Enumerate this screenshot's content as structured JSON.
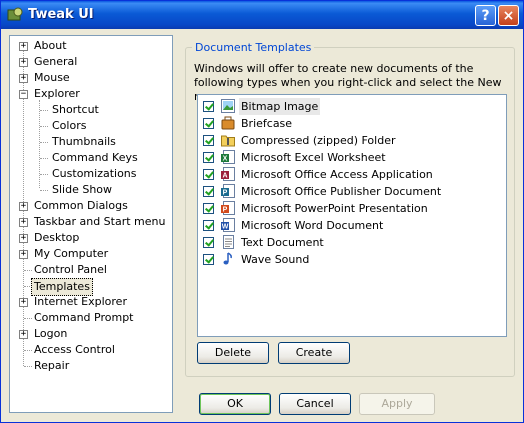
{
  "window": {
    "title": "Tweak UI"
  },
  "titlebar_buttons": {
    "help": "?",
    "close": "×"
  },
  "tree": {
    "items": [
      {
        "label": "About",
        "expander": "+"
      },
      {
        "label": "General",
        "expander": "+"
      },
      {
        "label": "Mouse",
        "expander": "+"
      },
      {
        "label": "Explorer",
        "expander": "−"
      },
      {
        "label": "Shortcut"
      },
      {
        "label": "Colors"
      },
      {
        "label": "Thumbnails"
      },
      {
        "label": "Command Keys"
      },
      {
        "label": "Customizations"
      },
      {
        "label": "Slide Show"
      },
      {
        "label": "Common Dialogs",
        "expander": "+"
      },
      {
        "label": "Taskbar and Start menu",
        "expander": "+"
      },
      {
        "label": "Desktop",
        "expander": "+"
      },
      {
        "label": "My Computer",
        "expander": "+"
      },
      {
        "label": "Control Panel"
      },
      {
        "label": "Templates",
        "selected": true
      },
      {
        "label": "Internet Explorer",
        "expander": "+"
      },
      {
        "label": "Command Prompt"
      },
      {
        "label": "Logon",
        "expander": "+"
      },
      {
        "label": "Access Control"
      },
      {
        "label": "Repair"
      }
    ]
  },
  "panel": {
    "group_title": "Document Templates",
    "description": "Windows will offer to create new documents of the following types when you right-click and select the New menu."
  },
  "templates": [
    {
      "label": "Bitmap Image",
      "checked": true,
      "icon": "bitmap-icon"
    },
    {
      "label": "Briefcase",
      "checked": true,
      "icon": "briefcase-icon"
    },
    {
      "label": "Compressed (zipped) Folder",
      "checked": true,
      "icon": "zip-folder-icon"
    },
    {
      "label": "Microsoft Excel Worksheet",
      "checked": true,
      "icon": "excel-icon"
    },
    {
      "label": "Microsoft Office Access Application",
      "checked": true,
      "icon": "access-icon"
    },
    {
      "label": "Microsoft Office Publisher Document",
      "checked": true,
      "icon": "publisher-icon"
    },
    {
      "label": "Microsoft PowerPoint Presentation",
      "checked": true,
      "icon": "powerpoint-icon"
    },
    {
      "label": "Microsoft Word Document",
      "checked": true,
      "icon": "word-icon"
    },
    {
      "label": "Text Document",
      "checked": true,
      "icon": "text-document-icon"
    },
    {
      "label": "Wave Sound",
      "checked": true,
      "icon": "wave-sound-icon"
    }
  ],
  "buttons": {
    "delete": "Delete",
    "create": "Create",
    "ok": "OK",
    "cancel": "Cancel",
    "apply": "Apply"
  },
  "colors": {
    "title_bar": "#0a5ad6",
    "group_title": "#0046d5",
    "dialog_bg": "#ece9d8",
    "check": "#21a121"
  }
}
